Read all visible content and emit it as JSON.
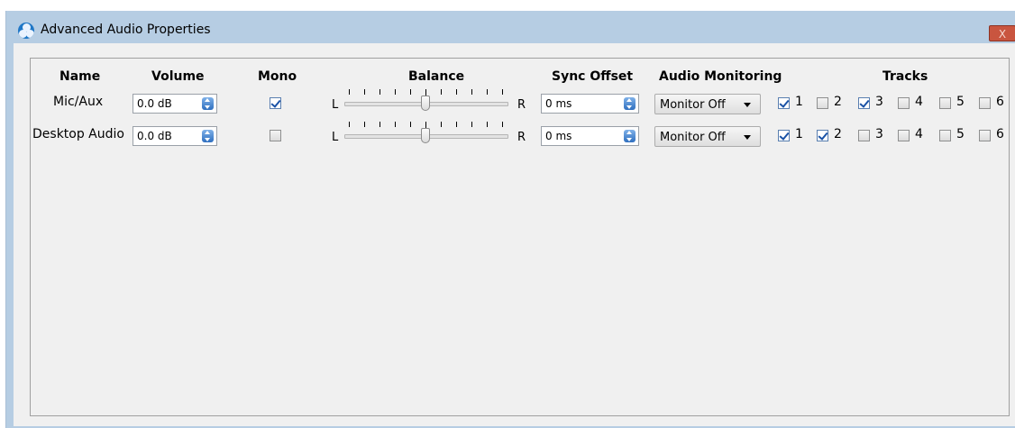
{
  "window": {
    "title": "Advanced Audio Properties",
    "close_label": "X"
  },
  "headers": {
    "name": "Name",
    "volume": "Volume",
    "mono": "Mono",
    "balance": "Balance",
    "sync_offset": "Sync Offset",
    "audio_monitoring": "Audio Monitoring",
    "tracks": "Tracks"
  },
  "balance_labels": {
    "left": "L",
    "right": "R"
  },
  "rows": [
    {
      "name": "Mic/Aux",
      "volume": "0.0 dB",
      "mono": true,
      "balance": 0.5,
      "sync_offset": "0 ms",
      "monitoring": "Monitor Off",
      "tracks": [
        {
          "label": "1",
          "checked": true
        },
        {
          "label": "2",
          "checked": false
        },
        {
          "label": "3",
          "checked": true
        },
        {
          "label": "4",
          "checked": false
        },
        {
          "label": "5",
          "checked": false
        },
        {
          "label": "6",
          "checked": false
        }
      ]
    },
    {
      "name": "Desktop Audio",
      "volume": "0.0 dB",
      "mono": false,
      "balance": 0.5,
      "sync_offset": "0 ms",
      "monitoring": "Monitor Off",
      "tracks": [
        {
          "label": "1",
          "checked": true
        },
        {
          "label": "2",
          "checked": true
        },
        {
          "label": "3",
          "checked": false
        },
        {
          "label": "4",
          "checked": false
        },
        {
          "label": "5",
          "checked": false
        },
        {
          "label": "6",
          "checked": false
        }
      ]
    }
  ],
  "colors": {
    "titlebar": "#b6cde3",
    "close_button": "#c9553f",
    "check_mark": "#1a52a6",
    "spin_arrows": "#2f6fbf"
  }
}
